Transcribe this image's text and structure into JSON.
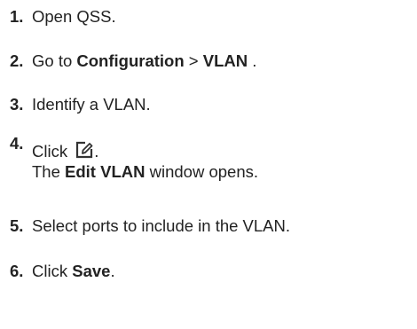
{
  "steps": [
    {
      "num": "1.",
      "text": "Open QSS."
    },
    {
      "num": "2.",
      "pre": "Go to ",
      "b1": "Configuration",
      "sep": " > ",
      "b2": "VLAN",
      "post": " ."
    },
    {
      "num": "3.",
      "text": "Identify a VLAN."
    },
    {
      "num": "4.",
      "pre": "Click ",
      "post": ".",
      "line2_pre": "The ",
      "line2_b": "Edit VLAN",
      "line2_post": " window opens."
    },
    {
      "num": "5.",
      "text": "Select ports to include in the VLAN."
    },
    {
      "num": "6.",
      "pre": "Click ",
      "b": "Save",
      "post": "."
    }
  ],
  "icons": {
    "step4_icon": "edit-icon"
  }
}
